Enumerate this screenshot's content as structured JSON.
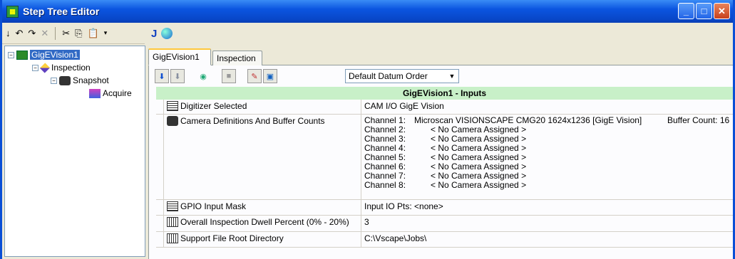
{
  "window": {
    "title": "Step Tree Editor"
  },
  "left_toolbar": {
    "icons": [
      "arrow-down-icon",
      "undo-icon",
      "redo-icon",
      "delete-icon",
      "cut-icon",
      "copy-icon",
      "paste-icon",
      "dropdown-icon"
    ]
  },
  "tree": {
    "items": [
      {
        "label": "GigEVision1",
        "selected": true
      },
      {
        "label": "Inspection"
      },
      {
        "label": "Snapshot"
      },
      {
        "label": "Acquire"
      }
    ]
  },
  "tabs": [
    {
      "label": "GigEVision1",
      "active": true
    },
    {
      "label": "Inspection",
      "active": false
    }
  ],
  "panel": {
    "datum_order": "Default Datum Order",
    "header": "GigEVision1 - Inputs",
    "rows": {
      "digitizer": {
        "name": "Digitizer Selected",
        "value": "CAM I/O GigE Vision"
      },
      "camera": {
        "name": "Camera Definitions And Buffer Counts",
        "channels": [
          {
            "label": "Channel 1:",
            "camera": "Microscan VISIONSCAPE CMG20 1624x1236 [GigE Vision]",
            "buffer": "Buffer Count: 16"
          },
          {
            "label": "Channel 2:",
            "camera": "< No Camera Assigned >"
          },
          {
            "label": "Channel 3:",
            "camera": "< No Camera Assigned >"
          },
          {
            "label": "Channel 4:",
            "camera": "< No Camera Assigned >"
          },
          {
            "label": "Channel 5:",
            "camera": "< No Camera Assigned >"
          },
          {
            "label": "Channel 6:",
            "camera": "< No Camera Assigned >"
          },
          {
            "label": "Channel 7:",
            "camera": "< No Camera Assigned >"
          },
          {
            "label": "Channel 8:",
            "camera": "< No Camera Assigned >"
          }
        ]
      },
      "gpio": {
        "name": "GPIO Input Mask",
        "value": "Input IO Pts: <none>"
      },
      "dwell": {
        "name": "Overall Inspection Dwell Percent (0% - 20%)",
        "value": "3"
      },
      "support": {
        "name": "Support File Root Directory",
        "value": "C:\\Vscape\\Jobs\\"
      }
    }
  }
}
